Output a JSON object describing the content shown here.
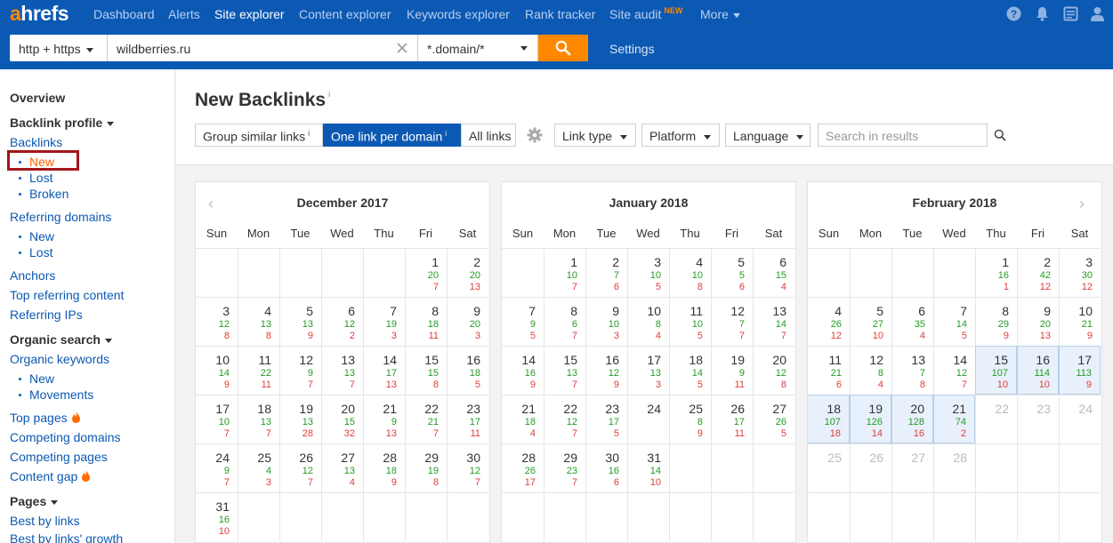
{
  "app": {
    "logo_a": "a",
    "logo_rest": "hrefs"
  },
  "nav": [
    {
      "label": "Dashboard"
    },
    {
      "label": "Alerts"
    },
    {
      "label": "Site explorer",
      "active": true
    },
    {
      "label": "Content explorer"
    },
    {
      "label": "Keywords explorer"
    },
    {
      "label": "Rank tracker"
    },
    {
      "label": "Site audit",
      "badge": "NEW"
    },
    {
      "label": "More"
    }
  ],
  "search": {
    "protocol": "http + https",
    "target": "wildberries.ru",
    "mode": "*.domain/*",
    "settings_label": "Settings"
  },
  "sidebar": {
    "overview": "Overview",
    "backlink_profile": "Backlink profile",
    "backlinks": "Backlinks",
    "backlinks_new": "New",
    "backlinks_lost": "Lost",
    "backlinks_broken": "Broken",
    "referring_domains": "Referring domains",
    "rd_new": "New",
    "rd_lost": "Lost",
    "anchors": "Anchors",
    "top_referring_content": "Top referring content",
    "referring_ips": "Referring IPs",
    "organic_search": "Organic search",
    "organic_keywords": "Organic keywords",
    "ok_new": "New",
    "ok_movements": "Movements",
    "top_pages": "Top pages",
    "competing_domains": "Competing domains",
    "competing_pages": "Competing pages",
    "content_gap": "Content gap",
    "pages": "Pages",
    "best_by_links": "Best by links",
    "best_by_links_growth": "Best by links' growth"
  },
  "main": {
    "title": "New Backlinks",
    "info": "i",
    "group_similar": "Group similar links",
    "one_per_domain": "One link per domain",
    "all_links": "All links",
    "link_type": "Link type",
    "platform": "Platform",
    "language": "Language",
    "search_placeholder": "Search in results"
  },
  "weekdays": [
    "Sun",
    "Mon",
    "Tue",
    "Wed",
    "Thu",
    "Fri",
    "Sat"
  ],
  "calendars": [
    {
      "title": "December 2017",
      "first_weekday": 5,
      "days": [
        [
          1,
          20,
          7
        ],
        [
          2,
          20,
          13
        ],
        [
          3,
          12,
          8
        ],
        [
          4,
          13,
          8
        ],
        [
          5,
          13,
          9
        ],
        [
          6,
          12,
          2
        ],
        [
          7,
          19,
          3
        ],
        [
          8,
          18,
          11
        ],
        [
          9,
          20,
          3
        ],
        [
          10,
          14,
          9
        ],
        [
          11,
          22,
          11
        ],
        [
          12,
          9,
          7
        ],
        [
          13,
          13,
          7
        ],
        [
          14,
          17,
          13
        ],
        [
          15,
          15,
          8
        ],
        [
          16,
          18,
          5
        ],
        [
          17,
          10,
          7
        ],
        [
          18,
          13,
          7
        ],
        [
          19,
          13,
          28
        ],
        [
          20,
          15,
          32
        ],
        [
          21,
          9,
          13
        ],
        [
          22,
          21,
          7
        ],
        [
          23,
          17,
          11
        ],
        [
          24,
          9,
          7
        ],
        [
          25,
          4,
          3
        ],
        [
          26,
          12,
          7
        ],
        [
          27,
          13,
          4
        ],
        [
          28,
          18,
          9
        ],
        [
          29,
          19,
          8
        ],
        [
          30,
          12,
          7
        ],
        [
          31,
          16,
          10
        ]
      ]
    },
    {
      "title": "January 2018",
      "first_weekday": 1,
      "days": [
        [
          1,
          10,
          7
        ],
        [
          2,
          7,
          6
        ],
        [
          3,
          10,
          5
        ],
        [
          4,
          10,
          8
        ],
        [
          5,
          5,
          6
        ],
        [
          6,
          15,
          4
        ],
        [
          7,
          9,
          5
        ],
        [
          8,
          6,
          7
        ],
        [
          9,
          10,
          3
        ],
        [
          10,
          8,
          4
        ],
        [
          11,
          10,
          5
        ],
        [
          12,
          7,
          7
        ],
        [
          13,
          14,
          7
        ],
        [
          14,
          16,
          9
        ],
        [
          15,
          13,
          7
        ],
        [
          16,
          12,
          9
        ],
        [
          17,
          13,
          3
        ],
        [
          18,
          14,
          5
        ],
        [
          19,
          9,
          11
        ],
        [
          20,
          12,
          8
        ],
        [
          21,
          18,
          4
        ],
        [
          22,
          12,
          7
        ],
        [
          23,
          17,
          5
        ],
        [
          24,
          null,
          null
        ],
        [
          25,
          8,
          9
        ],
        [
          26,
          17,
          11
        ],
        [
          27,
          26,
          5
        ],
        [
          28,
          26,
          17
        ],
        [
          29,
          23,
          7
        ],
        [
          30,
          16,
          6
        ],
        [
          31,
          14,
          10
        ]
      ]
    },
    {
      "title": "February 2018",
      "first_weekday": 4,
      "highlight_from": 15,
      "highlight_to": 21,
      "dim_from": 22,
      "days": [
        [
          1,
          16,
          1
        ],
        [
          2,
          42,
          12
        ],
        [
          3,
          30,
          12
        ],
        [
          4,
          26,
          12
        ],
        [
          5,
          27,
          10
        ],
        [
          6,
          35,
          4
        ],
        [
          7,
          14,
          5
        ],
        [
          8,
          29,
          9
        ],
        [
          9,
          20,
          13
        ],
        [
          10,
          21,
          9
        ],
        [
          11,
          21,
          6
        ],
        [
          12,
          8,
          4
        ],
        [
          13,
          7,
          8
        ],
        [
          14,
          12,
          7
        ],
        [
          15,
          107,
          10
        ],
        [
          16,
          114,
          10
        ],
        [
          17,
          113,
          9
        ],
        [
          18,
          107,
          18
        ],
        [
          19,
          126,
          14
        ],
        [
          20,
          128,
          16
        ],
        [
          21,
          74,
          2
        ],
        [
          22,
          null,
          null
        ],
        [
          23,
          null,
          null
        ],
        [
          24,
          null,
          null
        ],
        [
          25,
          null,
          null
        ],
        [
          26,
          null,
          null
        ],
        [
          27,
          null,
          null
        ],
        [
          28,
          null,
          null
        ]
      ]
    }
  ]
}
